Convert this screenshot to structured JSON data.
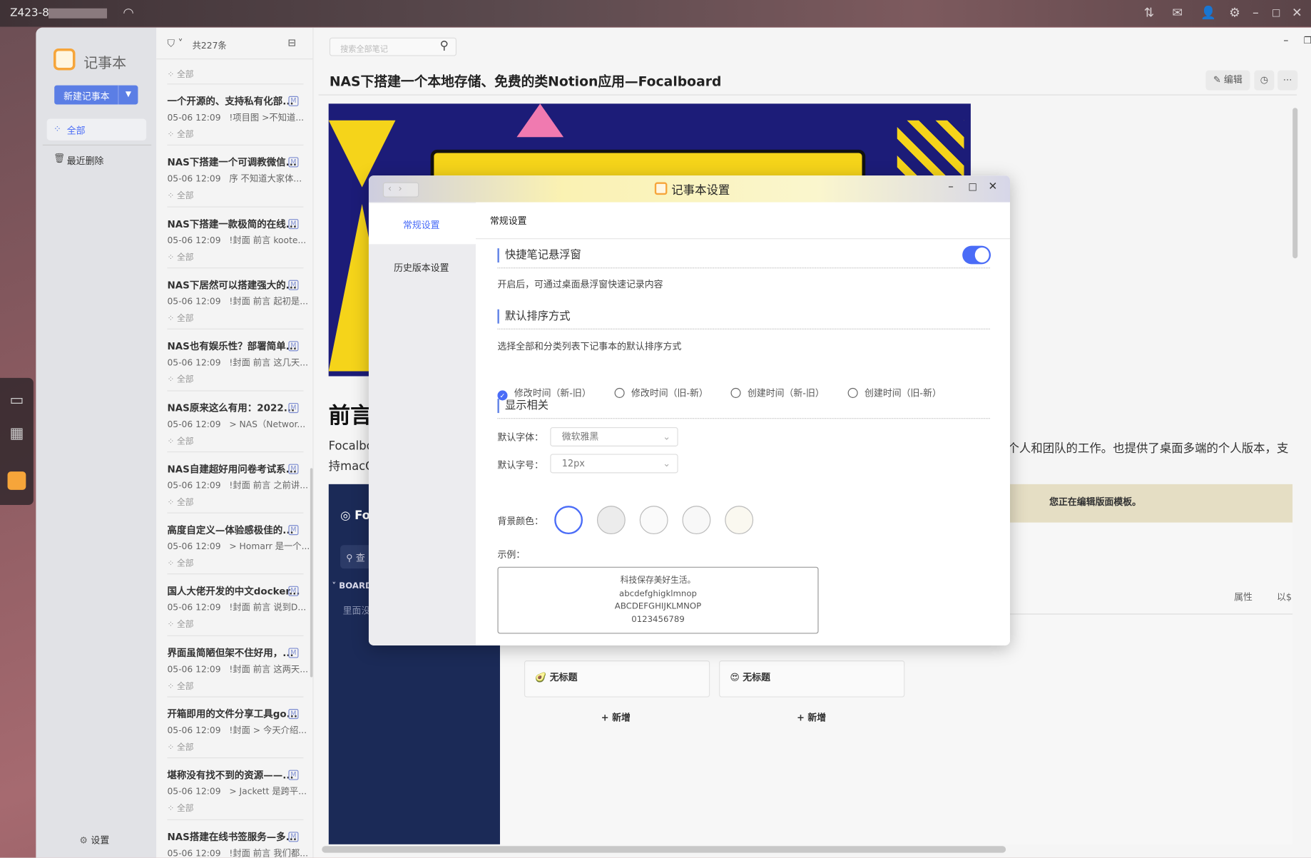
{
  "taskbar": {
    "host": "Z423-8",
    "wifi_icon": "wifi-icon",
    "right_icons": [
      "sort-icon",
      "mail-icon",
      "user-icon",
      "gear-icon",
      "minimize-icon",
      "maximize-icon",
      "close-icon"
    ]
  },
  "sidebar": {
    "app_name": "记事本",
    "new_button": "新建记事本",
    "items": [
      {
        "label": "全部",
        "active": true
      },
      {
        "label": "最近删除"
      }
    ],
    "settings": "设置"
  },
  "list": {
    "count": "共227条",
    "partial_tag": "全部",
    "notes": [
      {
        "title": "一个开源的、支持私有化部...",
        "date": "05-06 12:09",
        "preview": "!项目图 >不知道...",
        "tag": "全部"
      },
      {
        "title": "NAS下搭建一个可调教微信...",
        "date": "05-06 12:09",
        "preview": "序 不知道大家体...",
        "tag": "全部"
      },
      {
        "title": "NAS下搭建一款极简的在线...",
        "date": "05-06 12:09",
        "preview": "!封面 前言 koote...",
        "tag": "全部"
      },
      {
        "title": "NAS下居然可以搭建强大的...",
        "date": "05-06 12:09",
        "preview": "!封面 前言 起初是...",
        "tag": "全部"
      },
      {
        "title": "NAS也有娱乐性？部署简单...",
        "date": "05-06 12:09",
        "preview": "!封面 前言 这几天...",
        "tag": "全部"
      },
      {
        "title": "NAS原来这么有用：2022...",
        "date": "05-06 12:09",
        "preview": "> NAS（Networ...",
        "tag": "全部"
      },
      {
        "title": "NAS自建超好用问卷考试系...",
        "date": "05-06 12:09",
        "preview": "!封面 前言 之前讲...",
        "tag": "全部"
      },
      {
        "title": "高度自定义—体验感极佳的...",
        "date": "05-06 12:09",
        "preview": "> Homarr 是一个...",
        "tag": "全部"
      },
      {
        "title": "国人大佬开发的中文docker...",
        "date": "05-06 12:09",
        "preview": "!封面 前言 说到D...",
        "tag": "全部"
      },
      {
        "title": "界面虽简陋但架不住好用，...",
        "date": "05-06 12:09",
        "preview": "!封面 前言 这两天...",
        "tag": "全部"
      },
      {
        "title": "开箱即用的文件分享工具go...",
        "date": "05-06 12:09",
        "preview": "!封面 > 今天介绍...",
        "tag": "全部"
      },
      {
        "title": "堪称没有找不到的资源——...",
        "date": "05-06 12:09",
        "preview": "> Jackett 是跨平...",
        "tag": "全部"
      },
      {
        "title": "NAS搭建在线书签服务—多...",
        "date": "05-06 12:09",
        "preview": "!封面 前言 我们都...",
        "tag": "全部"
      }
    ],
    "badge": "M"
  },
  "main": {
    "search_placeholder": "搜索全部笔记",
    "title": "NAS下搭建一个本地存储、免费的类Notion应用—Focalboard",
    "edit": "编辑",
    "heading": "前言",
    "para1": "Focalbo",
    "para1_right": "个人和团队的工作。也提供了桌面多端的个人版本，支",
    "para2": "持macC",
    "embed": {
      "logo": "Fo",
      "search": "查",
      "board": "BOARD",
      "sub": "里面没",
      "banner": "您正在编辑版面模板。",
      "props": "属性",
      "more": "以$",
      "cards": [
        "无标题",
        "无标题"
      ],
      "add": "+ 新增"
    }
  },
  "dialog": {
    "title": "记事本设置",
    "nav": [
      {
        "label": "常规设置",
        "active": true
      },
      {
        "label": "历史版本设置"
      }
    ],
    "header": "常规设置",
    "float": {
      "title": "快捷笔记悬浮窗",
      "enabled": true,
      "desc": "开启后，可通过桌面悬浮窗快速记录内容"
    },
    "sort": {
      "title": "默认排序方式",
      "desc": "选择全部和分类列表下记事本的默认排序方式",
      "options": [
        "修改时间（新-旧）",
        "修改时间（旧-新）",
        "创建时间（新-旧）",
        "创建时间（旧-新）"
      ],
      "selected": 0
    },
    "display": {
      "title": "显示相关",
      "font_label": "默认字体：",
      "font_value": "微软雅黑",
      "size_label": "默认字号：",
      "size_value": "12px",
      "bg_label": "背景颜色：",
      "bg_colors": [
        "#ffffff",
        "#ececec",
        "#fafafa",
        "#f8f8f8",
        "#faf8f0"
      ],
      "bg_selected": 0,
      "sample_label": "示例：",
      "sample": [
        "科技保存美好生活。",
        "abcdefghigklmnop",
        "ABCDEFGHIJKLMNOP",
        "0123456789"
      ]
    },
    "accent": "#4a6cf7"
  }
}
